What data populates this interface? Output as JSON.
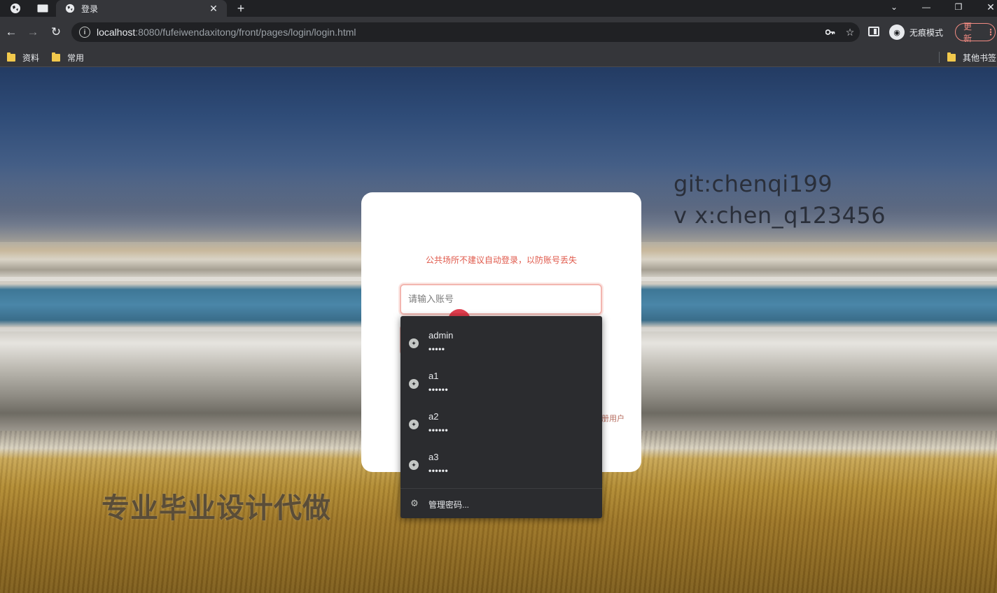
{
  "browser": {
    "tab": {
      "title": "登录"
    },
    "url": {
      "host": "localhost",
      "rest": ":8080/fufeiwendaxitong/front/pages/login/login.html"
    },
    "profile_label": "无痕模式",
    "update_label": "更新",
    "bookmarks": [
      {
        "label": "资料"
      },
      {
        "label": "常用"
      }
    ],
    "other_bookmarks_label": "其他书签"
  },
  "watermarks": {
    "git": "git:chenqi199",
    "vx": "v x:chen_q123456",
    "ad": "专业毕业设计代做"
  },
  "login": {
    "notice": "公共场所不建议自动登录，以防账号丢失",
    "account_placeholder": "请输入账号",
    "register_link_fragment": "册用户"
  },
  "autofill": {
    "entries": [
      {
        "username": "admin",
        "password_mask": "•••••"
      },
      {
        "username": "a1",
        "password_mask": "••••••"
      },
      {
        "username": "a2",
        "password_mask": "••••••"
      },
      {
        "username": "a3",
        "password_mask": "••••••"
      }
    ],
    "manage_label": "管理密码..."
  },
  "colors": {
    "accent_red": "#e05a4c",
    "dropdown_bg": "#2b2c2f",
    "chrome_dark": "#202124"
  }
}
